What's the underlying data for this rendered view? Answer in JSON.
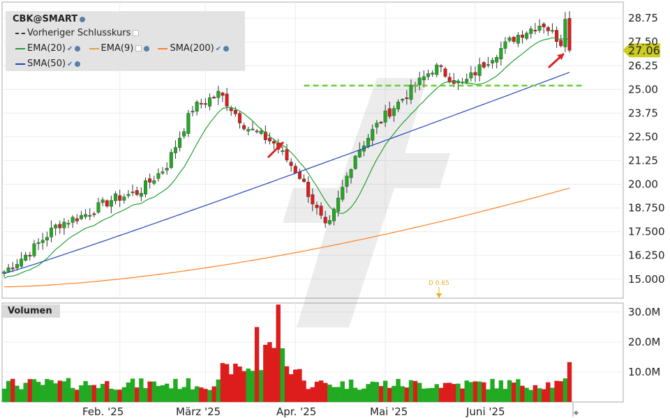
{
  "symbol": "CBK@SMART",
  "legend": {
    "prev_close": "Vorheriger Schlusskurs",
    "ema20": "EMA(20)",
    "ema9": "EMA(9)",
    "sma200": "SMA(200)",
    "sma50": "SMA(50)"
  },
  "volume_label": "Volumen",
  "last_price_label": "27.06",
  "dividend_marker": "D 0.65",
  "colors": {
    "up": "#22aa22",
    "down": "#dd1c1c",
    "ema20": "#22a033",
    "ema9": "#e8a040",
    "sma200": "#ff7f1e",
    "sma50": "#2244bb",
    "prev_close": "#66cc33",
    "price_tag": "#cccc22"
  },
  "chart_data": [
    {
      "type": "candlestick",
      "price_axis_ticks": [
        "28.75",
        "27.50",
        "26.25",
        "25.00",
        "23.75",
        "22.50",
        "21.25",
        "20.00",
        "18.750",
        "17.500",
        "16.250",
        "15.000"
      ],
      "ylim": [
        14.0,
        29.6
      ],
      "x_tick_labels": [
        "Feb. '25",
        "März '25",
        "Apr. '25",
        "Mai '25",
        "Juni '25"
      ],
      "previous_close": 25.2,
      "last_price": 27.06,
      "dividend": "D 0.65",
      "series": [
        {
          "name": "EMA(20)",
          "start": 15.4,
          "end": 27.4
        },
        {
          "name": "SMA(50)",
          "start": 15.3,
          "end": 25.9
        },
        {
          "name": "SMA(200)",
          "start": 14.6,
          "end": 19.8
        }
      ],
      "approx_path": [
        15.4,
        16.5,
        17.9,
        18.4,
        19.2,
        19.6,
        20.9,
        24.0,
        24.8,
        23.0,
        22.2,
        20.4,
        17.5,
        21.5,
        23.4,
        24.8,
        26.2,
        25.2,
        26.6,
        27.8,
        28.5,
        27.0
      ],
      "bar_count": 133
    },
    {
      "type": "bar",
      "title": "Volumen",
      "y_tick_labels": [
        "30.0M",
        "20.0M",
        "10.0M"
      ],
      "ylim": [
        0,
        33
      ],
      "peak_volume_millions": 32.5,
      "last_volume_millions": 13.3
    }
  ]
}
